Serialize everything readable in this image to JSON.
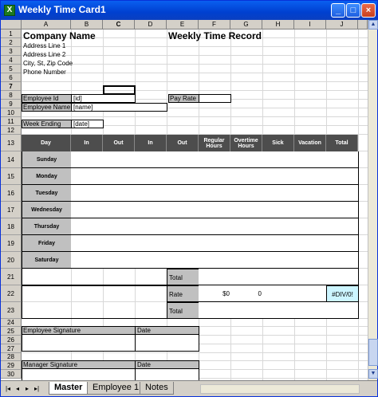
{
  "window": {
    "title": "Weekly Time Card1",
    "minimize": "_",
    "restore": "□",
    "close": "×"
  },
  "columns": [
    "A",
    "B",
    "C",
    "D",
    "E",
    "F",
    "G",
    "H",
    "I",
    "J"
  ],
  "rows": [
    "1",
    "2",
    "3",
    "4",
    "5",
    "6",
    "7",
    "8",
    "9",
    "10",
    "11",
    "12",
    "13",
    "14",
    "15",
    "16",
    "17",
    "18",
    "19",
    "20",
    "21",
    "22",
    "23",
    "24",
    "25",
    "26",
    "27",
    "28",
    "29",
    "30"
  ],
  "header": {
    "company": "Company Name",
    "address1": "Address Line 1",
    "address2": "Address Line 2",
    "city": "City, St, Zip Code",
    "phone": "Phone Number",
    "doc_title": "Weekly Time Record"
  },
  "employee": {
    "id_label": "Employee Id",
    "id_value": "[id]",
    "name_label": "Employee Name",
    "name_value": "[name]",
    "pay_rate_label": "Pay Rate",
    "week_label": "Week Ending",
    "week_value": "[date]"
  },
  "table": {
    "headers": [
      "Day",
      "In",
      "Out",
      "In",
      "Out",
      "Regular Hours",
      "Overtime Hours",
      "Sick",
      "Vacation",
      "Total"
    ],
    "days": [
      "Sunday",
      "Monday",
      "Tuesday",
      "Wednesday",
      "Thursday",
      "Friday",
      "Saturday"
    ]
  },
  "summary": {
    "total1": "Total",
    "rate": "Rate",
    "rate_regular": "$0",
    "rate_overtime": "0",
    "rate_total": "#DIV/0!",
    "total2": "Total"
  },
  "signatures": {
    "employee_sig": "Employee Signature",
    "manager_sig": "Manager Signature",
    "date": "Date"
  },
  "tabs": [
    "Master",
    "Employee 1",
    "Notes"
  ],
  "nav": [
    "|◂",
    "◂",
    "▸",
    "▸|"
  ],
  "colors": {
    "title_bar": "#0040d0",
    "header_dark": "#4d4d4d",
    "label_gray": "#c0c0c0",
    "div_cell": "#ccf5ff"
  }
}
